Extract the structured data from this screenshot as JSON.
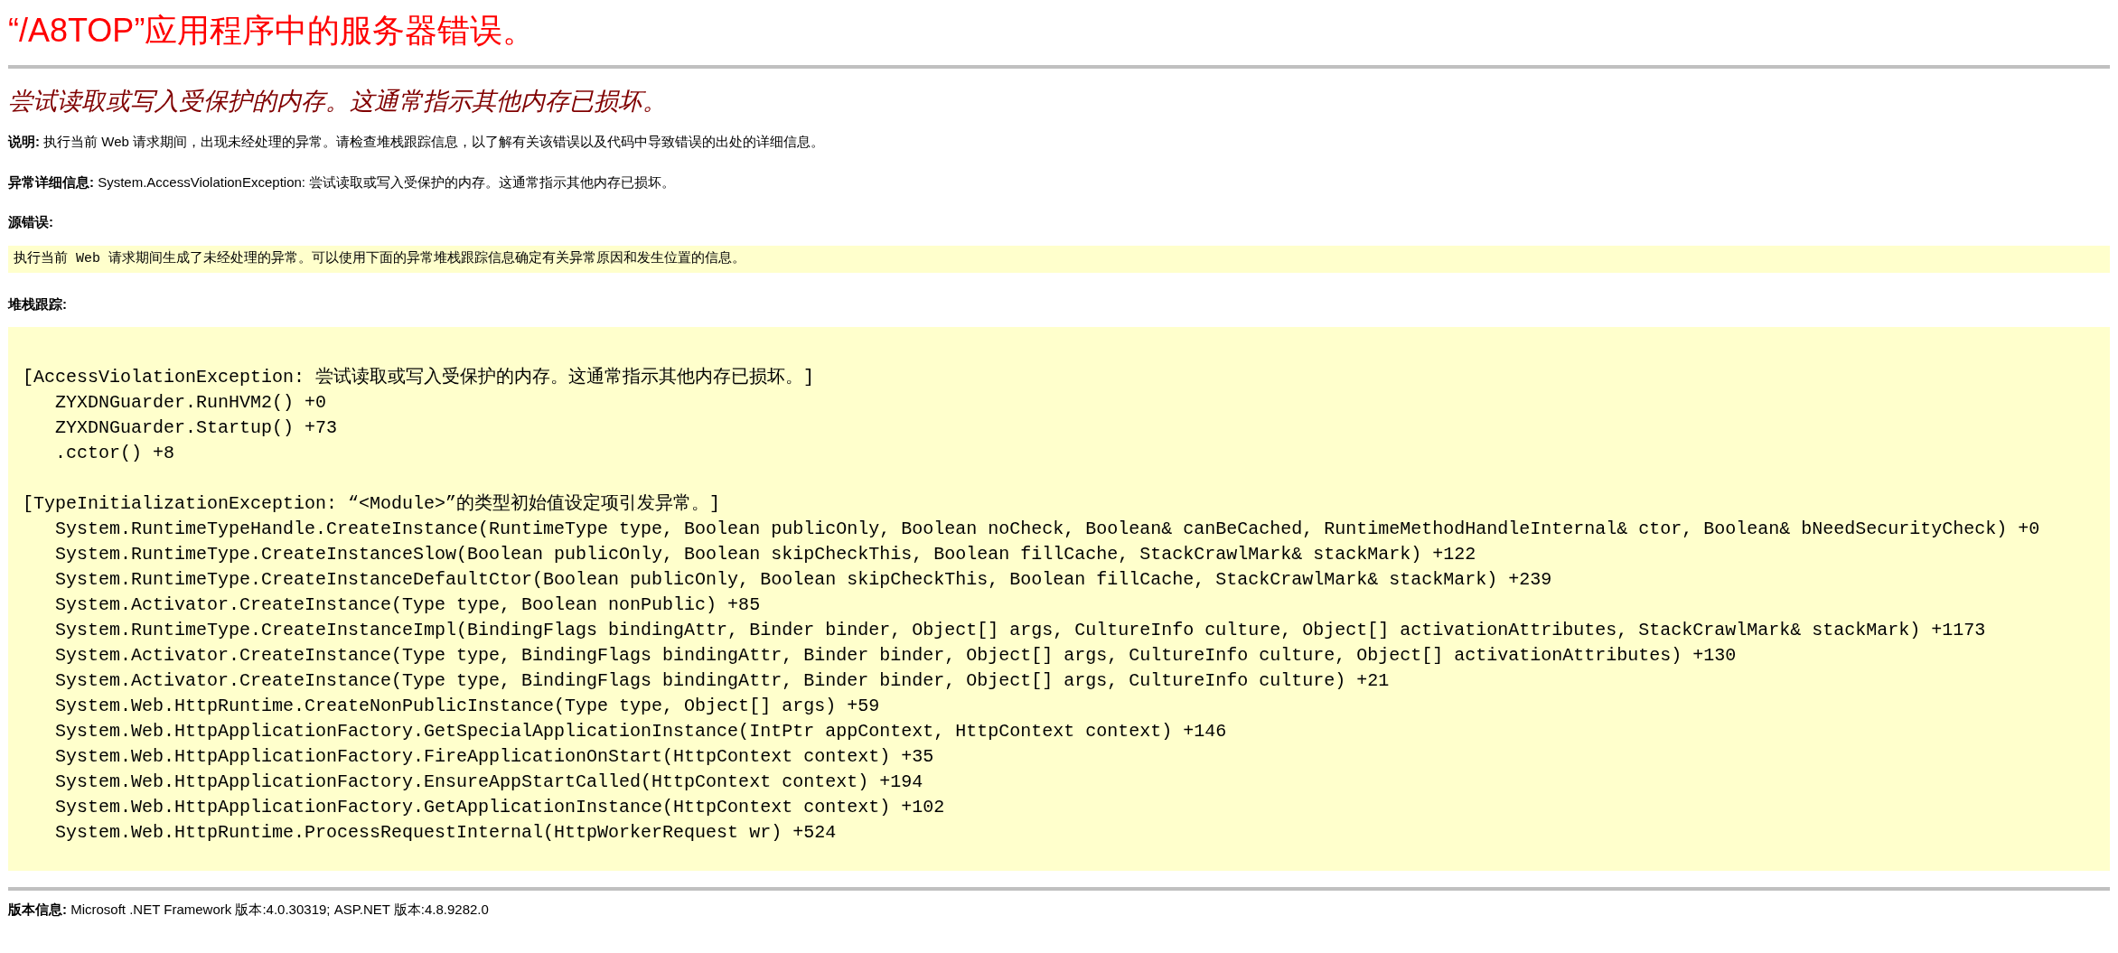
{
  "title": "“/A8TOP”应用程序中的服务器错误。",
  "error_message": "尝试读取或写入受保护的内存。这通常指示其他内存已损坏。",
  "description": {
    "label": "说明:",
    "text": "执行当前 Web 请求期间，出现未经处理的异常。请检查堆栈跟踪信息，以了解有关该错误以及代码中导致错误的出处的详细信息。"
  },
  "exception_details": {
    "label": "异常详细信息:",
    "text": "System.AccessViolationException: 尝试读取或写入受保护的内存。这通常指示其他内存已损坏。"
  },
  "source_error": {
    "label": "源错误:",
    "text": "执行当前 Web 请求期间生成了未经处理的异常。可以使用下面的异常堆栈跟踪信息确定有关异常原因和发生位置的信息。"
  },
  "stack_trace": {
    "label": "堆栈跟踪:",
    "blocks": [
      {
        "header": "[AccessViolationException: 尝试读取或写入受保护的内存。这通常指示其他内存已损坏。]",
        "frames": [
          "ZYXDNGuarder.RunHVM2() +0",
          "ZYXDNGuarder.Startup() +73",
          ".cctor() +8"
        ]
      },
      {
        "header": "[TypeInitializationException: “<Module>”的类型初始值设定项引发异常。]",
        "frames": [
          "System.RuntimeTypeHandle.CreateInstance(RuntimeType type, Boolean publicOnly, Boolean noCheck, Boolean& canBeCached, RuntimeMethodHandleInternal& ctor, Boolean& bNeedSecurityCheck) +0",
          "System.RuntimeType.CreateInstanceSlow(Boolean publicOnly, Boolean skipCheckThis, Boolean fillCache, StackCrawlMark& stackMark) +122",
          "System.RuntimeType.CreateInstanceDefaultCtor(Boolean publicOnly, Boolean skipCheckThis, Boolean fillCache, StackCrawlMark& stackMark) +239",
          "System.Activator.CreateInstance(Type type, Boolean nonPublic) +85",
          "System.RuntimeType.CreateInstanceImpl(BindingFlags bindingAttr, Binder binder, Object[] args, CultureInfo culture, Object[] activationAttributes, StackCrawlMark& stackMark) +1173",
          "System.Activator.CreateInstance(Type type, BindingFlags bindingAttr, Binder binder, Object[] args, CultureInfo culture, Object[] activationAttributes) +130",
          "System.Activator.CreateInstance(Type type, BindingFlags bindingAttr, Binder binder, Object[] args, CultureInfo culture) +21",
          "System.Web.HttpRuntime.CreateNonPublicInstance(Type type, Object[] args) +59",
          "System.Web.HttpApplicationFactory.GetSpecialApplicationInstance(IntPtr appContext, HttpContext context) +146",
          "System.Web.HttpApplicationFactory.FireApplicationOnStart(HttpContext context) +35",
          "System.Web.HttpApplicationFactory.EnsureAppStartCalled(HttpContext context) +194",
          "System.Web.HttpApplicationFactory.GetApplicationInstance(HttpContext context) +102",
          "System.Web.HttpRuntime.ProcessRequestInternal(HttpWorkerRequest wr) +524"
        ]
      }
    ]
  },
  "version": {
    "label": "版本信息:",
    "text": "Microsoft .NET Framework 版本:4.0.30319; ASP.NET 版本:4.8.9282.0"
  }
}
